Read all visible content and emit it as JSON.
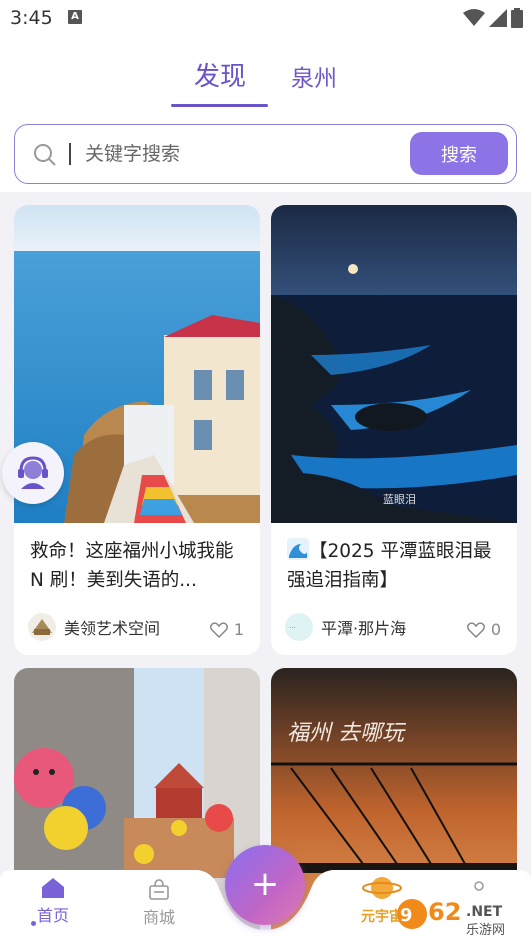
{
  "status_bar": {
    "time": "3:45",
    "notif": "A"
  },
  "tabs": {
    "discover": "发现",
    "city": "泉州"
  },
  "search": {
    "placeholder": "关键字搜索",
    "button": "搜索"
  },
  "cards": [
    {
      "title": "救命！这座福州小城我能 N 刷！美到失语的...",
      "author": "美领艺术空间",
      "likes": "1"
    },
    {
      "title": "【2025 平潭蓝眼泪最强追泪指南】",
      "author": "平潭·那片海",
      "likes": "0",
      "image_caption": "蓝眼泪"
    },
    {
      "title": "",
      "author": "",
      "likes": ""
    },
    {
      "title": "",
      "author": "",
      "likes": "",
      "image_caption": "福州 去哪玩"
    }
  ],
  "bottom_nav": {
    "home": "首页",
    "mall": "商城",
    "add": "+",
    "universe": "元宇宙"
  },
  "watermark": "962.NET 乐游网",
  "colors": {
    "accent": "#6a52c8",
    "button": "#8c73e6"
  }
}
